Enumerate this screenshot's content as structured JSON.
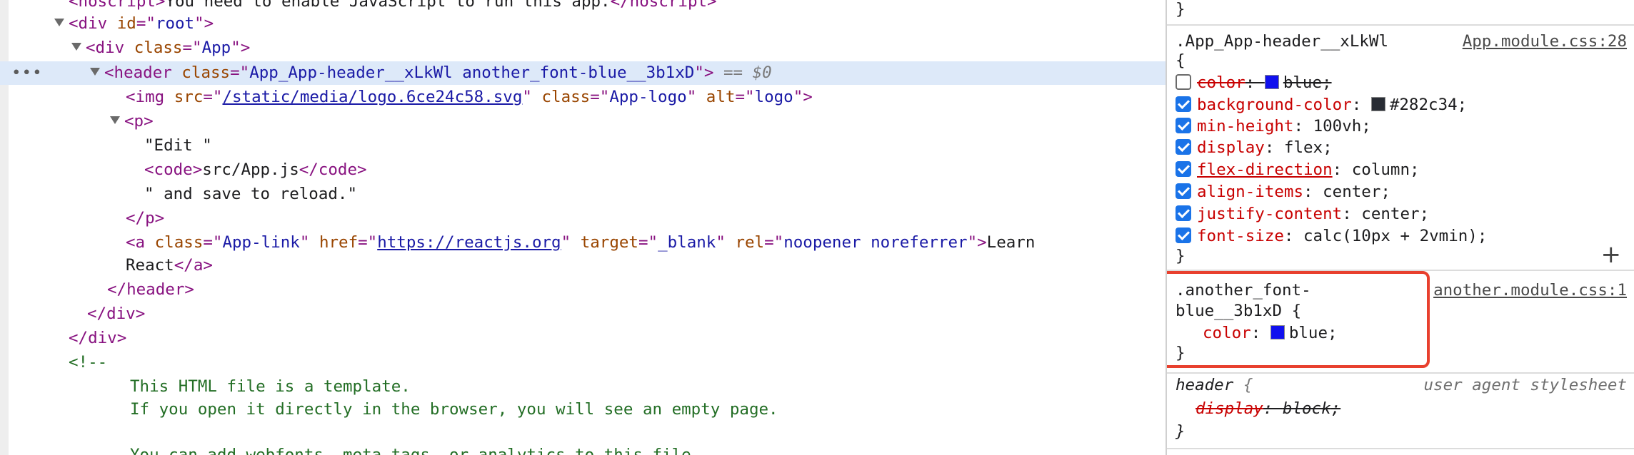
{
  "elements": {
    "noscript_line": {
      "open": "noscript>",
      "text": "You need to enable JavaScript to run this app.",
      "close": "</noscript>"
    },
    "div_root": {
      "tag": "div",
      "attr": "id",
      "val": "root"
    },
    "div_app": {
      "tag": "div",
      "attr": "class",
      "val": "App"
    },
    "header_selected": {
      "tag": "header",
      "attr": "class",
      "val": "App_App-header__xLkWl another_font-blue__3b1xD",
      "dollar": "== $0",
      "dots": "•••"
    },
    "img_line": {
      "tag": "img",
      "attr1": "src",
      "val1": "/static/media/logo.6ce24c58.svg",
      "attr2": "class",
      "val2": "App-logo",
      "attr3": "alt",
      "val3": "logo"
    },
    "p_open": {
      "tag": "p"
    },
    "edit_text": "\"Edit \"",
    "code_line": {
      "tag": "code",
      "text": "src/App.js"
    },
    "save_text": "\" and save to reload.\"",
    "p_close": "</p>",
    "a_line": {
      "tag": "a",
      "attr1": "class",
      "val1": "App-link",
      "attr2": "href",
      "val2": "https://reactjs.org",
      "attr3": "target",
      "val3": "_blank",
      "attr4": "rel",
      "val4": "noopener noreferrer",
      "text": "Learn"
    },
    "react_line": {
      "text": "React",
      "close": "</a>"
    },
    "header_close": "</header>",
    "div_close1": "</div>",
    "div_close2": "</div>",
    "comment_open": "<!--",
    "comment_lines": [
      "This HTML file is a template.",
      "If you open it directly in the browser, you will see an empty page.",
      "",
      "You can add webfonts, meta tags, or analytics to this file."
    ]
  },
  "styles": {
    "top_brace": "}",
    "rule1": {
      "selector": ".App_App-header__xLkWl",
      "source": "App.module.css:28",
      "open": "{",
      "props": [
        {
          "name": "color",
          "value": "blue",
          "checked": false,
          "struck": true,
          "swatch": "#1010ee"
        },
        {
          "name": "background-color",
          "value": "#282c34",
          "checked": true,
          "struck": false,
          "swatch": "#282c34"
        },
        {
          "name": "min-height",
          "value": "100vh",
          "checked": true,
          "struck": false
        },
        {
          "name": "display",
          "value": "flex",
          "checked": true,
          "struck": false
        },
        {
          "name": "flex-direction",
          "value": "column",
          "checked": true,
          "struck": false,
          "underline": true
        },
        {
          "name": "align-items",
          "value": "center",
          "checked": true,
          "struck": false
        },
        {
          "name": "justify-content",
          "value": "center",
          "checked": true,
          "struck": false
        },
        {
          "name": "font-size",
          "value": "calc(10px + 2vmin)",
          "checked": true,
          "struck": false
        }
      ],
      "close": "}"
    },
    "rule2": {
      "selector_line1": ".another_font-",
      "selector_line2": "blue__3b1xD",
      "open": "{",
      "source": "another.module.css:1",
      "prop_name": "color",
      "prop_value": "blue",
      "swatch": "#1010ee",
      "close": "}"
    },
    "rule3": {
      "selector": "header",
      "open": "{",
      "source": "user agent stylesheet",
      "prop_name": "display",
      "prop_value": "block",
      "close": "}"
    }
  }
}
